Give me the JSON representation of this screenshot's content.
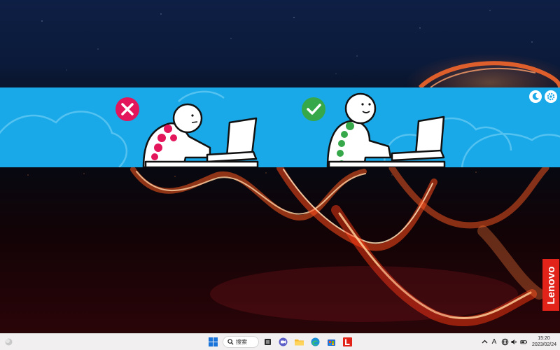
{
  "banner": {
    "wrong_posture_icon": "cross-icon",
    "correct_posture_icon": "check-icon",
    "colors": {
      "background": "#1aa9e8",
      "bad": "#e3165b",
      "good": "#36a84a"
    },
    "buttons": [
      {
        "name": "dark-mode-button",
        "icon": "moon-icon"
      },
      {
        "name": "settings-button",
        "icon": "gear-icon"
      }
    ]
  },
  "desktop": {
    "brand_label": "Lenovo"
  },
  "taskbar": {
    "search_label": "搜索",
    "apps": [
      "widgets",
      "start",
      "search",
      "task-view",
      "meet",
      "file-explorer",
      "edge",
      "store",
      "lenovo-vantage"
    ],
    "tray": {
      "chevron_icon": "chevron-up-icon",
      "ime_label": "A",
      "network_icon": "globe-icon",
      "volume_icon": "speaker-icon",
      "battery_icon": "battery-icon"
    },
    "clock": {
      "time": "15:20",
      "date": "2023/02/24"
    }
  }
}
